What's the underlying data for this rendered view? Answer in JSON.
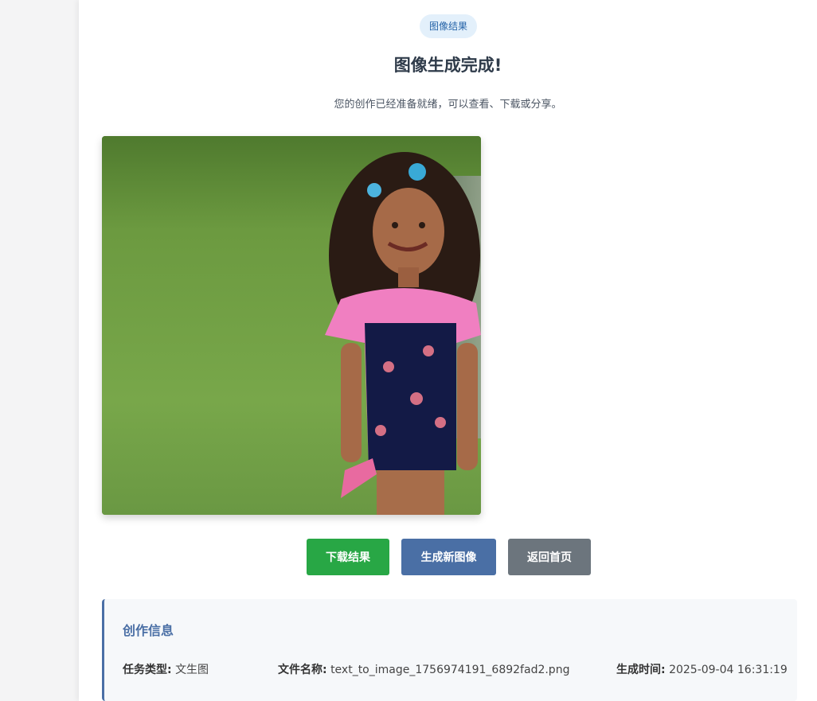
{
  "badge": "图像结果",
  "title": "图像生成完成!",
  "subtitle": "您的创作已经准备就绪，可以查看、下载或分享。",
  "result_image": {
    "alt": "generated image"
  },
  "buttons": {
    "download": "下载结果",
    "generate_new": "生成新图像",
    "home": "返回首页"
  },
  "info": {
    "title": "创作信息",
    "task_type_label": "任务类型:",
    "task_type_value": "文生图",
    "file_name_label": "文件名称:",
    "file_name_value": "text_to_image_1756974191_6892fad2.png",
    "time_label": "生成时间:",
    "time_value": "2025-09-04 16:31:19"
  },
  "colors": {
    "accent": "#4a6fa5",
    "success": "#28a745",
    "secondary": "#6c757d"
  }
}
